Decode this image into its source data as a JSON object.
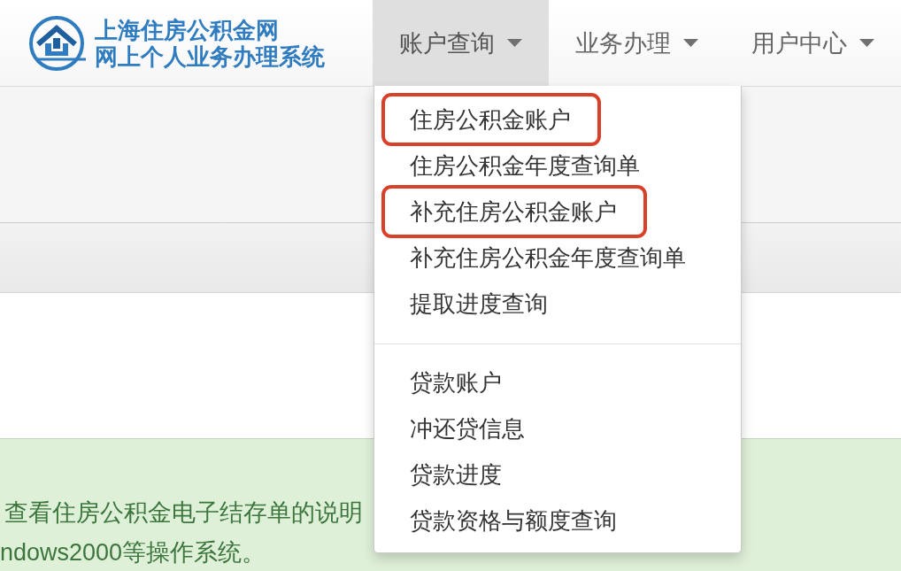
{
  "logo": {
    "title": "上海住房公积金网",
    "subtitle": "网上个人业务办理系统"
  },
  "nav": [
    {
      "label": "账户查询",
      "selected": true
    },
    {
      "label": "业务办理",
      "selected": false
    },
    {
      "label": "用户中心",
      "selected": false
    }
  ],
  "dropdown": {
    "groups": [
      {
        "items": [
          {
            "label": "住房公积金账户",
            "circled": true
          },
          {
            "label": "住房公积金年度查询单",
            "circled": false
          },
          {
            "label": "补充住房公积金账户",
            "circled": true
          },
          {
            "label": "补充住房公积金年度查询单",
            "circled": false
          },
          {
            "label": "提取进度查询",
            "circled": false
          }
        ]
      },
      {
        "items": [
          {
            "label": "贷款账户",
            "circled": false
          },
          {
            "label": "冲还贷信息",
            "circled": false
          },
          {
            "label": "贷款进度",
            "circled": false
          },
          {
            "label": "贷款资格与额度查询",
            "circled": false
          }
        ]
      }
    ]
  },
  "notice": {
    "lines": [
      "查看住房公积金电子结存单的说明",
      "ndows2000等操作系统。"
    ]
  }
}
